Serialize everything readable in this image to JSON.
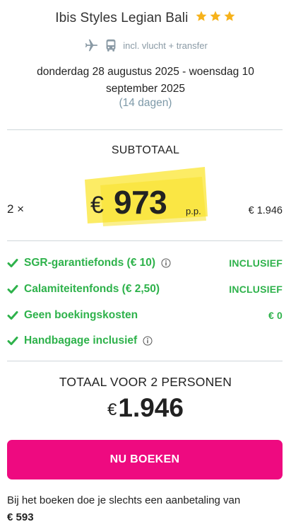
{
  "hotel": {
    "name": "Ibis Styles Legian Bali",
    "stars": 3,
    "star_color": "#f6b21b"
  },
  "transport": {
    "icons": [
      "plane-icon",
      "bus-icon"
    ],
    "text": "incl. vlucht + transfer"
  },
  "trip": {
    "dates": "donderdag 28 augustus 2025 - woensdag 10 september 2025",
    "duration": "(14 dagen)"
  },
  "subtotal": {
    "label": "SUBTOTAAL",
    "quantity": "2 ×",
    "currency": "€",
    "price_per_person": "973",
    "pp_label": "p.p.",
    "price_total": "€ 1.946",
    "highlight_color": "#fbe94a"
  },
  "features": [
    {
      "label": "SGR-garantiefonds  (€ 10)",
      "info": true,
      "value": "INCLUSIEF"
    },
    {
      "label": "Calamiteitenfonds  (€ 2,50)",
      "info": false,
      "value": "INCLUSIEF"
    },
    {
      "label": "Geen boekingskosten",
      "info": false,
      "value": "€ 0"
    },
    {
      "label": "Handbagage inclusief",
      "info": true,
      "value": ""
    }
  ],
  "feature_color": "#2eb24b",
  "total": {
    "label": "TOTAAL VOOR 2 PERSONEN",
    "currency": "€",
    "value": "1.946"
  },
  "book_button": {
    "label": "NU BOEKEN",
    "color": "#ee0a80"
  },
  "payment_note": {
    "text": "Bij het boeken doe je slechts een aanbetaling van",
    "amount": "€ 593"
  }
}
